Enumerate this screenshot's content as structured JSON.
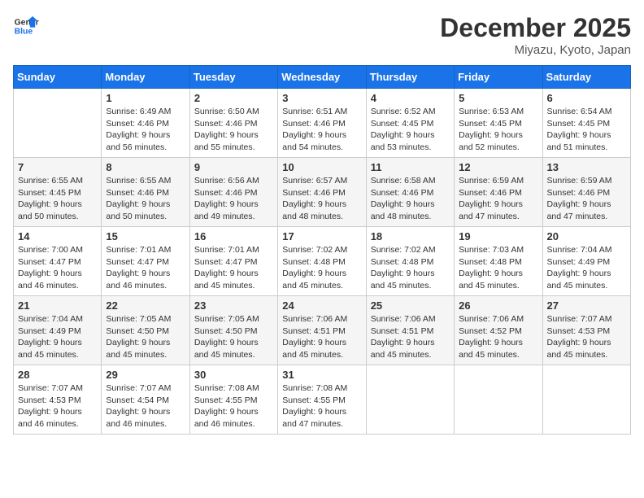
{
  "logo": {
    "line1": "General",
    "line2": "Blue"
  },
  "header": {
    "month": "December 2025",
    "location": "Miyazu, Kyoto, Japan"
  },
  "weekdays": [
    "Sunday",
    "Monday",
    "Tuesday",
    "Wednesday",
    "Thursday",
    "Friday",
    "Saturday"
  ],
  "weeks": [
    [
      {
        "day": "",
        "sunrise": "",
        "sunset": "",
        "daylight": ""
      },
      {
        "day": "1",
        "sunrise": "Sunrise: 6:49 AM",
        "sunset": "Sunset: 4:46 PM",
        "daylight": "Daylight: 9 hours and 56 minutes."
      },
      {
        "day": "2",
        "sunrise": "Sunrise: 6:50 AM",
        "sunset": "Sunset: 4:46 PM",
        "daylight": "Daylight: 9 hours and 55 minutes."
      },
      {
        "day": "3",
        "sunrise": "Sunrise: 6:51 AM",
        "sunset": "Sunset: 4:46 PM",
        "daylight": "Daylight: 9 hours and 54 minutes."
      },
      {
        "day": "4",
        "sunrise": "Sunrise: 6:52 AM",
        "sunset": "Sunset: 4:45 PM",
        "daylight": "Daylight: 9 hours and 53 minutes."
      },
      {
        "day": "5",
        "sunrise": "Sunrise: 6:53 AM",
        "sunset": "Sunset: 4:45 PM",
        "daylight": "Daylight: 9 hours and 52 minutes."
      },
      {
        "day": "6",
        "sunrise": "Sunrise: 6:54 AM",
        "sunset": "Sunset: 4:45 PM",
        "daylight": "Daylight: 9 hours and 51 minutes."
      }
    ],
    [
      {
        "day": "7",
        "sunrise": "Sunrise: 6:55 AM",
        "sunset": "Sunset: 4:45 PM",
        "daylight": "Daylight: 9 hours and 50 minutes."
      },
      {
        "day": "8",
        "sunrise": "Sunrise: 6:55 AM",
        "sunset": "Sunset: 4:46 PM",
        "daylight": "Daylight: 9 hours and 50 minutes."
      },
      {
        "day": "9",
        "sunrise": "Sunrise: 6:56 AM",
        "sunset": "Sunset: 4:46 PM",
        "daylight": "Daylight: 9 hours and 49 minutes."
      },
      {
        "day": "10",
        "sunrise": "Sunrise: 6:57 AM",
        "sunset": "Sunset: 4:46 PM",
        "daylight": "Daylight: 9 hours and 48 minutes."
      },
      {
        "day": "11",
        "sunrise": "Sunrise: 6:58 AM",
        "sunset": "Sunset: 4:46 PM",
        "daylight": "Daylight: 9 hours and 48 minutes."
      },
      {
        "day": "12",
        "sunrise": "Sunrise: 6:59 AM",
        "sunset": "Sunset: 4:46 PM",
        "daylight": "Daylight: 9 hours and 47 minutes."
      },
      {
        "day": "13",
        "sunrise": "Sunrise: 6:59 AM",
        "sunset": "Sunset: 4:46 PM",
        "daylight": "Daylight: 9 hours and 47 minutes."
      }
    ],
    [
      {
        "day": "14",
        "sunrise": "Sunrise: 7:00 AM",
        "sunset": "Sunset: 4:47 PM",
        "daylight": "Daylight: 9 hours and 46 minutes."
      },
      {
        "day": "15",
        "sunrise": "Sunrise: 7:01 AM",
        "sunset": "Sunset: 4:47 PM",
        "daylight": "Daylight: 9 hours and 46 minutes."
      },
      {
        "day": "16",
        "sunrise": "Sunrise: 7:01 AM",
        "sunset": "Sunset: 4:47 PM",
        "daylight": "Daylight: 9 hours and 45 minutes."
      },
      {
        "day": "17",
        "sunrise": "Sunrise: 7:02 AM",
        "sunset": "Sunset: 4:48 PM",
        "daylight": "Daylight: 9 hours and 45 minutes."
      },
      {
        "day": "18",
        "sunrise": "Sunrise: 7:02 AM",
        "sunset": "Sunset: 4:48 PM",
        "daylight": "Daylight: 9 hours and 45 minutes."
      },
      {
        "day": "19",
        "sunrise": "Sunrise: 7:03 AM",
        "sunset": "Sunset: 4:48 PM",
        "daylight": "Daylight: 9 hours and 45 minutes."
      },
      {
        "day": "20",
        "sunrise": "Sunrise: 7:04 AM",
        "sunset": "Sunset: 4:49 PM",
        "daylight": "Daylight: 9 hours and 45 minutes."
      }
    ],
    [
      {
        "day": "21",
        "sunrise": "Sunrise: 7:04 AM",
        "sunset": "Sunset: 4:49 PM",
        "daylight": "Daylight: 9 hours and 45 minutes."
      },
      {
        "day": "22",
        "sunrise": "Sunrise: 7:05 AM",
        "sunset": "Sunset: 4:50 PM",
        "daylight": "Daylight: 9 hours and 45 minutes."
      },
      {
        "day": "23",
        "sunrise": "Sunrise: 7:05 AM",
        "sunset": "Sunset: 4:50 PM",
        "daylight": "Daylight: 9 hours and 45 minutes."
      },
      {
        "day": "24",
        "sunrise": "Sunrise: 7:06 AM",
        "sunset": "Sunset: 4:51 PM",
        "daylight": "Daylight: 9 hours and 45 minutes."
      },
      {
        "day": "25",
        "sunrise": "Sunrise: 7:06 AM",
        "sunset": "Sunset: 4:51 PM",
        "daylight": "Daylight: 9 hours and 45 minutes."
      },
      {
        "day": "26",
        "sunrise": "Sunrise: 7:06 AM",
        "sunset": "Sunset: 4:52 PM",
        "daylight": "Daylight: 9 hours and 45 minutes."
      },
      {
        "day": "27",
        "sunrise": "Sunrise: 7:07 AM",
        "sunset": "Sunset: 4:53 PM",
        "daylight": "Daylight: 9 hours and 45 minutes."
      }
    ],
    [
      {
        "day": "28",
        "sunrise": "Sunrise: 7:07 AM",
        "sunset": "Sunset: 4:53 PM",
        "daylight": "Daylight: 9 hours and 46 minutes."
      },
      {
        "day": "29",
        "sunrise": "Sunrise: 7:07 AM",
        "sunset": "Sunset: 4:54 PM",
        "daylight": "Daylight: 9 hours and 46 minutes."
      },
      {
        "day": "30",
        "sunrise": "Sunrise: 7:08 AM",
        "sunset": "Sunset: 4:55 PM",
        "daylight": "Daylight: 9 hours and 46 minutes."
      },
      {
        "day": "31",
        "sunrise": "Sunrise: 7:08 AM",
        "sunset": "Sunset: 4:55 PM",
        "daylight": "Daylight: 9 hours and 47 minutes."
      },
      {
        "day": "",
        "sunrise": "",
        "sunset": "",
        "daylight": ""
      },
      {
        "day": "",
        "sunrise": "",
        "sunset": "",
        "daylight": ""
      },
      {
        "day": "",
        "sunrise": "",
        "sunset": "",
        "daylight": ""
      }
    ]
  ]
}
